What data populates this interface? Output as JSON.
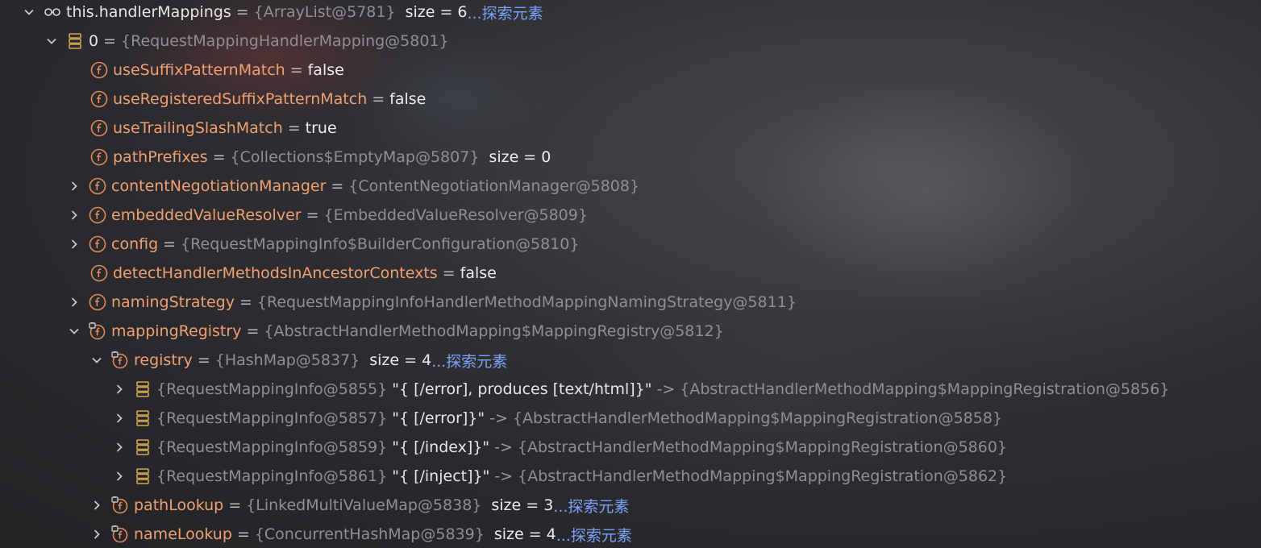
{
  "icons": {
    "expanded": "chevron-down-icon",
    "collapsed": "chevron-right-icon",
    "watch": "glasses-icon",
    "field": "field-f-icon",
    "field_private": "field-f-lock-icon",
    "array_element": "array-element-icon"
  },
  "colors": {
    "field_name": "#f0a070",
    "reference": "#8e8e94",
    "link": "#7aa2f7",
    "field_icon": "#e08a5a",
    "array_icon": "#d4a84e"
  },
  "rows": [
    {
      "name": "this.handlerMappings",
      "ref": "{ArrayList@5781}",
      "size_label": "size = 6",
      "link": "...探索元素"
    },
    {
      "name": "0",
      "ref": "{RequestMappingHandlerMapping@5801}"
    },
    {
      "name": "useSuffixPatternMatch",
      "value": "false"
    },
    {
      "name": "useRegisteredSuffixPatternMatch",
      "value": "false"
    },
    {
      "name": "useTrailingSlashMatch",
      "value": "true"
    },
    {
      "name": "pathPrefixes",
      "ref": "{Collections$EmptyMap@5807}",
      "size_label": "size = 0"
    },
    {
      "name": "contentNegotiationManager",
      "ref": "{ContentNegotiationManager@5808}"
    },
    {
      "name": "embeddedValueResolver",
      "ref": "{EmbeddedValueResolver@5809}"
    },
    {
      "name": "config",
      "ref": "{RequestMappingInfo$BuilderConfiguration@5810}"
    },
    {
      "name": "detectHandlerMethodsInAncestorContexts",
      "value": "false"
    },
    {
      "name": "namingStrategy",
      "ref": "{RequestMappingInfoHandlerMethodMappingNamingStrategy@5811}"
    },
    {
      "name": "mappingRegistry",
      "ref": "{AbstractHandlerMethodMapping$MappingRegistry@5812}"
    },
    {
      "name": "registry",
      "ref": "{HashMap@5837}",
      "size_label": "size = 4",
      "link": "...探索元素"
    },
    {
      "key_ref": "{RequestMappingInfo@5855}",
      "key_str": "\"{ [/error], produces [text/html]}\"",
      "arrow": "->",
      "value_ref": "{AbstractHandlerMethodMapping$MappingRegistration@5856}"
    },
    {
      "key_ref": "{RequestMappingInfo@5857}",
      "key_str": "\"{ [/error]}\"",
      "arrow": "->",
      "value_ref": "{AbstractHandlerMethodMapping$MappingRegistration@5858}"
    },
    {
      "key_ref": "{RequestMappingInfo@5859}",
      "key_str": "\"{ [/index]}\"",
      "arrow": "->",
      "value_ref": "{AbstractHandlerMethodMapping$MappingRegistration@5860}"
    },
    {
      "key_ref": "{RequestMappingInfo@5861}",
      "key_str": "\"{ [/inject]}\"",
      "arrow": "->",
      "value_ref": "{AbstractHandlerMethodMapping$MappingRegistration@5862}"
    },
    {
      "name": "pathLookup",
      "ref": "{LinkedMultiValueMap@5838}",
      "size_label": "size = 3",
      "link": "...探索元素"
    },
    {
      "name": "nameLookup",
      "ref": "{ConcurrentHashMap@5839}",
      "size_label": "size = 4",
      "link": "...探索元素"
    }
  ]
}
